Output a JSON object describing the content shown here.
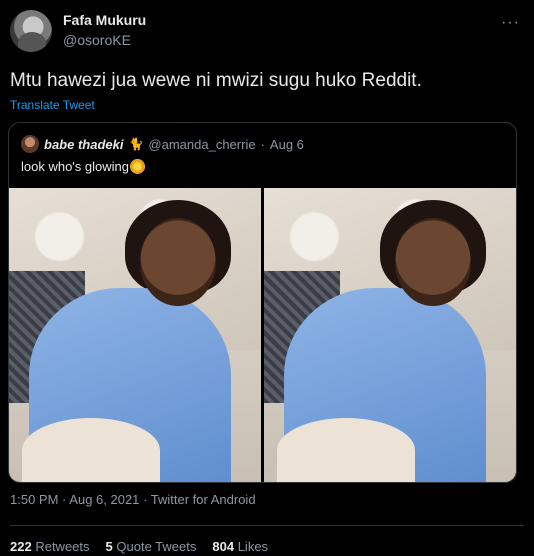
{
  "author": {
    "name": "Fafa Mukuru",
    "handle": "@osoroKE"
  },
  "more_icon": "more-icon",
  "tweet_text": "Mtu hawezi jua wewe ni mwizi sugu huko Reddit.",
  "translate_label": "Translate Tweet",
  "quote": {
    "name": "babe thadeki",
    "emoji": "🐈",
    "handle": "@amanda_cherrie",
    "separator": "·",
    "date": "Aug 6",
    "text": "look who's glowing",
    "icon": "sun-icon"
  },
  "meta": {
    "time": "1:50 PM",
    "separator": "·",
    "date": "Aug 6, 2021",
    "source": "Twitter for Android"
  },
  "stats": [
    {
      "count": "222",
      "label": "Retweets"
    },
    {
      "count": "5",
      "label": "Quote Tweets"
    },
    {
      "count": "804",
      "label": "Likes"
    }
  ],
  "colors": {
    "background": "#000000",
    "link": "#1d9bf0",
    "muted": "#8b98a5",
    "border": "#2f3336"
  }
}
